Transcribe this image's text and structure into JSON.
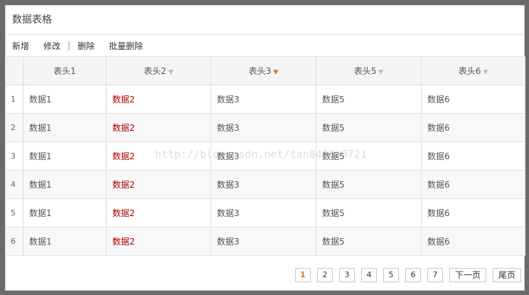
{
  "panel": {
    "title": "数据表格"
  },
  "toolbar": {
    "add": "新增",
    "edit": "修改",
    "separator": "|",
    "delete": "删除",
    "batch_delete": "批量删除"
  },
  "table": {
    "headers": [
      "表头1",
      "表头2",
      "表头3",
      "表头5",
      "表头6"
    ],
    "rows": [
      {
        "index": "1",
        "cells": [
          "数据1",
          "数据2",
          "数据3",
          "数据5",
          "数据6"
        ]
      },
      {
        "index": "2",
        "cells": [
          "数据1",
          "数据2",
          "数据3",
          "数据5",
          "数据6"
        ]
      },
      {
        "index": "3",
        "cells": [
          "数据1",
          "数据2",
          "数据3",
          "数据5",
          "数据6"
        ]
      },
      {
        "index": "4",
        "cells": [
          "数据1",
          "数据2",
          "数据3",
          "数据5",
          "数据6"
        ]
      },
      {
        "index": "5",
        "cells": [
          "数据1",
          "数据2",
          "数据3",
          "数据5",
          "数据6"
        ]
      },
      {
        "index": "6",
        "cells": [
          "数据1",
          "数据2",
          "数据3",
          "数据5",
          "数据6"
        ]
      }
    ]
  },
  "pager": {
    "pages": [
      "1",
      "2",
      "3",
      "4",
      "5",
      "6",
      "7"
    ],
    "current": "1",
    "next": "下一页",
    "last": "尾页"
  },
  "watermark": "http://blog.csdn.net/tan840880721",
  "colors": {
    "accent": "#e5740c",
    "highlight_text": "#b00000"
  }
}
